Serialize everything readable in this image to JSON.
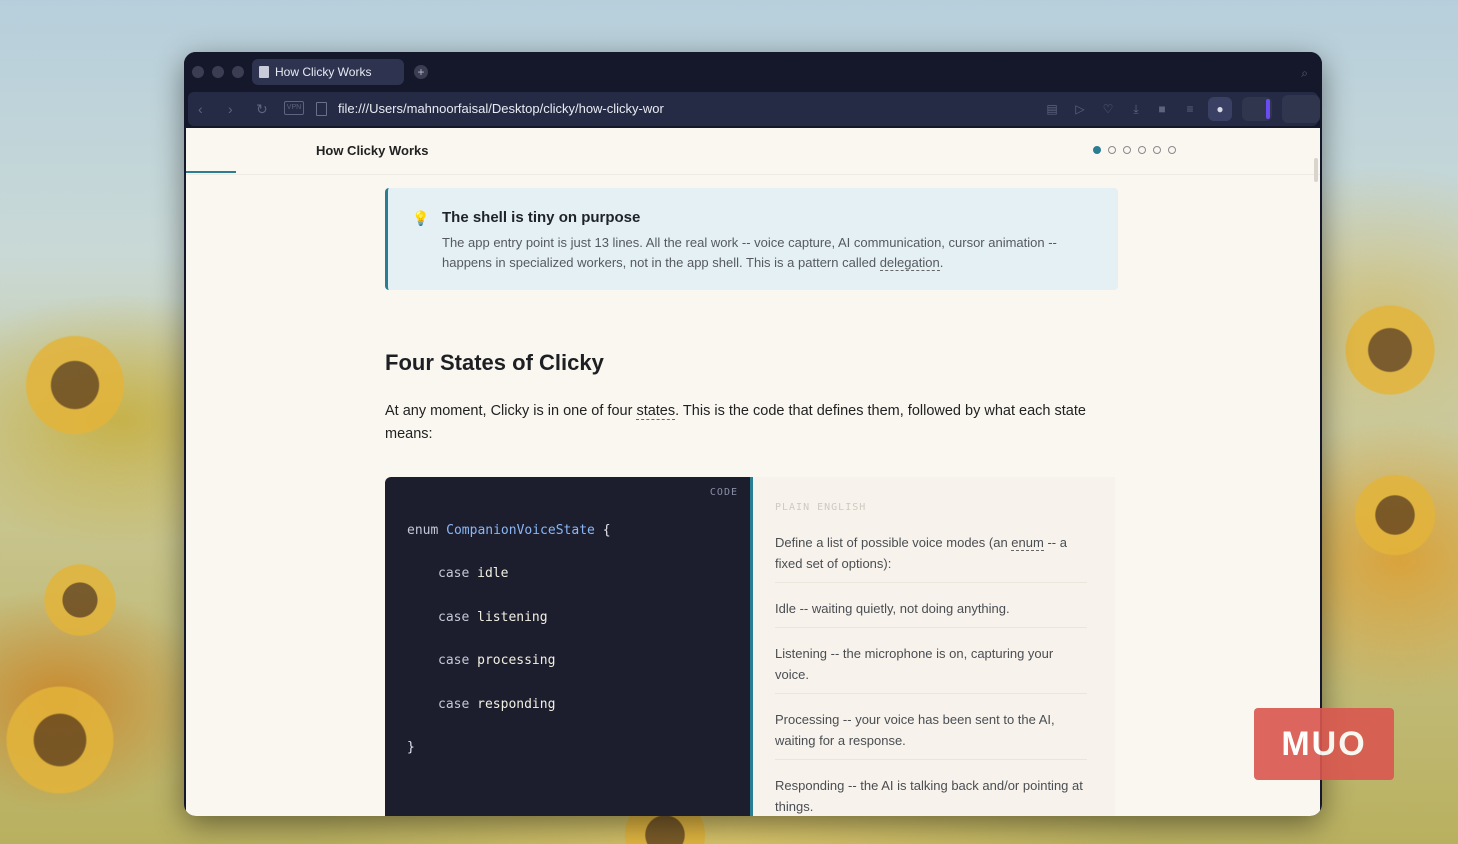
{
  "browser": {
    "tab_title": "How Clicky Works",
    "new_tab_symbol": "+",
    "url": "file:///Users/mahnoorfaisal/Desktop/clicky/how-clicky-wor",
    "vpn_label": "VPN",
    "back_symbol": "‹",
    "forward_symbol": "›",
    "reload_symbol": "↻",
    "search_symbol": "⌕"
  },
  "page": {
    "header_title": "How Clicky Works",
    "progress_dots": 6,
    "active_dot": 0,
    "accent_color": "#2a7d92"
  },
  "callout": {
    "icon": "lightbulb-icon",
    "title": "The shell is tiny on purpose",
    "body_pre": "The app entry point is just 13 lines. All the real work -- voice capture, AI communication, cursor animation -- happens in specialized workers, not in the app shell. This is a pattern called ",
    "term": "delegation",
    "body_post": "."
  },
  "section": {
    "heading": "Four States of Clicky",
    "intro_pre": "At any moment, Clicky is in one of four ",
    "intro_term": "states",
    "intro_post": ". This is the code that defines them, followed by what each state means:"
  },
  "code": {
    "label": "CODE",
    "enum_keyword": "enum",
    "type_name": "CompanionVoiceState",
    "open_brace": "{",
    "case_keyword": "case",
    "cases": [
      "idle",
      "listening",
      "processing",
      "responding"
    ],
    "close_brace": "}"
  },
  "plain": {
    "label": "PLAIN ENGLISH",
    "item0_pre": "Define a list of possible voice modes (an ",
    "item0_term": "enum",
    "item0_post": " -- a fixed set of options):",
    "item1": "Idle -- waiting quietly, not doing anything.",
    "item2": "Listening -- the microphone is on, capturing your voice.",
    "item3": "Processing -- your voice has been sent to the AI, waiting for a response.",
    "item4": "Responding -- the AI is talking back and/or pointing at things."
  },
  "watermark": {
    "text": "MUO"
  }
}
